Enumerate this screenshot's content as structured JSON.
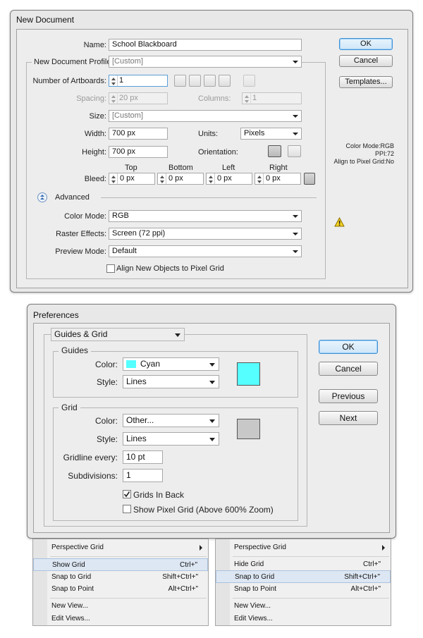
{
  "new_document": {
    "title": "New Document",
    "name_label": "Name:",
    "name_value": "School Blackboard",
    "profile_label": "New Document Profile:",
    "profile_value": "[Custom]",
    "artboards_label": "Number of Artboards:",
    "artboards_value": "1",
    "spacing_label": "Spacing:",
    "spacing_value": "20 px",
    "columns_label": "Columns:",
    "columns_value": "1",
    "size_label": "Size:",
    "size_value": "[Custom]",
    "width_label": "Width:",
    "width_value": "700 px",
    "units_label": "Units:",
    "units_value": "Pixels",
    "height_label": "Height:",
    "height_value": "700 px",
    "orientation_label": "Orientation:",
    "bleed_label": "Bleed:",
    "bleed_top_label": "Top",
    "bleed_bottom_label": "Bottom",
    "bleed_left_label": "Left",
    "bleed_right_label": "Right",
    "bleed_top": "0 px",
    "bleed_bottom": "0 px",
    "bleed_left": "0 px",
    "bleed_right": "0 px",
    "advanced_label": "Advanced",
    "color_mode_label": "Color Mode:",
    "color_mode_value": "RGB",
    "raster_label": "Raster Effects:",
    "raster_value": "Screen (72 ppi)",
    "preview_label": "Preview Mode:",
    "preview_value": "Default",
    "align_label": "Align New Objects to Pixel Grid",
    "ok": "OK",
    "cancel": "Cancel",
    "templates": "Templates...",
    "info_color_mode": "Color Mode:RGB",
    "info_ppi": "PPI:72",
    "info_align": "Align to Pixel Grid:No"
  },
  "preferences": {
    "title": "Preferences",
    "section_value": "Guides & Grid",
    "guides_legend": "Guides",
    "guides_color_label": "Color:",
    "guides_color_value": "Cyan",
    "guides_style_label": "Style:",
    "guides_style_value": "Lines",
    "grid_legend": "Grid",
    "grid_color_label": "Color:",
    "grid_color_value": "Other...",
    "grid_style_label": "Style:",
    "grid_style_value": "Lines",
    "gridline_label": "Gridline every:",
    "gridline_value": "10 pt",
    "subdivisions_label": "Subdivisions:",
    "subdivisions_value": "1",
    "grids_in_back_label": "Grids In Back",
    "show_pixel_grid_label": "Show Pixel Grid (Above 600% Zoom)",
    "ok": "OK",
    "cancel": "Cancel",
    "previous": "Previous",
    "next": "Next",
    "guides_color_hex": "#55ffff",
    "grid_color_hex": "#c8c8c8"
  },
  "menu_left": {
    "perspective": "Perspective Grid",
    "grid_item": "Show Grid",
    "grid_shortcut": "Ctrl+\"",
    "snap_grid": "Snap to Grid",
    "snap_grid_shortcut": "Shift+Ctrl+\"",
    "snap_point": "Snap to Point",
    "snap_point_shortcut": "Alt+Ctrl+\"",
    "new_view": "New View...",
    "edit_views": "Edit Views..."
  },
  "menu_right": {
    "perspective": "Perspective Grid",
    "grid_item": "Hide Grid",
    "grid_shortcut": "Ctrl+\"",
    "snap_grid": "Snap to Grid",
    "snap_grid_shortcut": "Shift+Ctrl+\"",
    "snap_point": "Snap to Point",
    "snap_point_shortcut": "Alt+Ctrl+\"",
    "new_view": "New View...",
    "edit_views": "Edit Views..."
  }
}
